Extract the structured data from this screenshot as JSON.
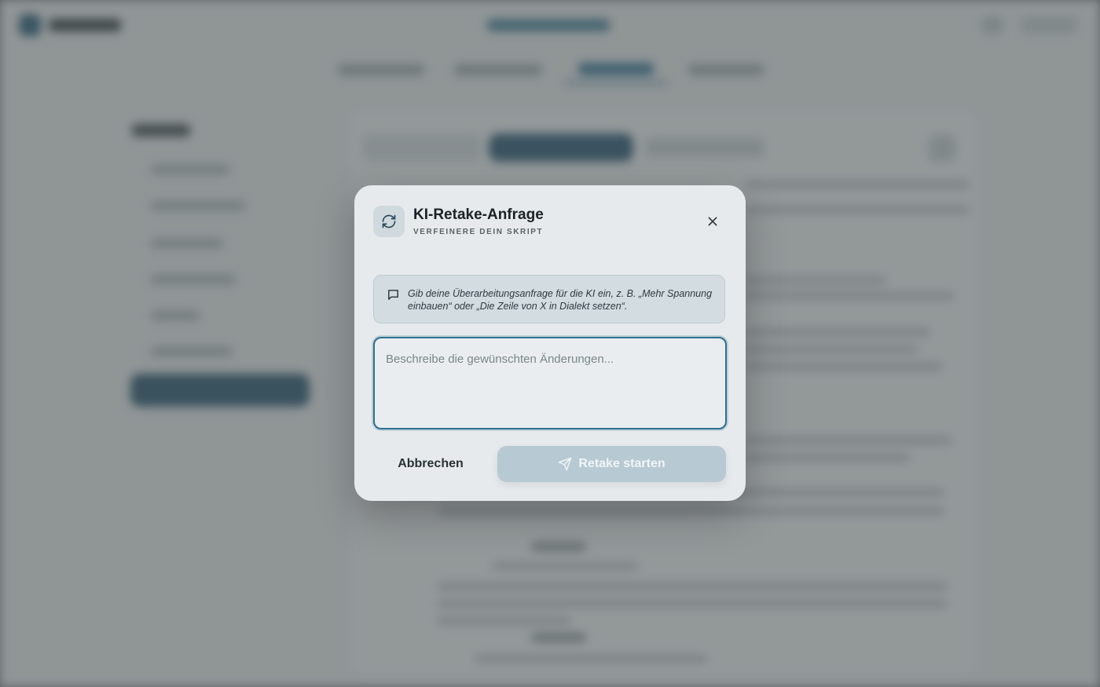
{
  "modal": {
    "title": "KI-Retake-Anfrage",
    "subtitle": "VERFEINERE DEIN SKRIPT",
    "info_text": "Gib deine Überarbeitungsanfrage für die KI ein, z. B. „Mehr Spannung einbauen“ oder „Die Zeile von X in Dialekt setzen“.",
    "textarea": {
      "value": "",
      "placeholder": "Beschreibe die gewünschten Änderungen..."
    },
    "cancel_label": "Abbrechen",
    "start_label": "Retake starten",
    "icons": {
      "header": "refresh-icon",
      "close": "close-icon",
      "info": "message-square-icon",
      "start": "send-icon"
    }
  },
  "colors": {
    "accent": "#2e6f90",
    "modal_bg": "#e6eaec",
    "button_disabled": "#b7c9d2"
  }
}
